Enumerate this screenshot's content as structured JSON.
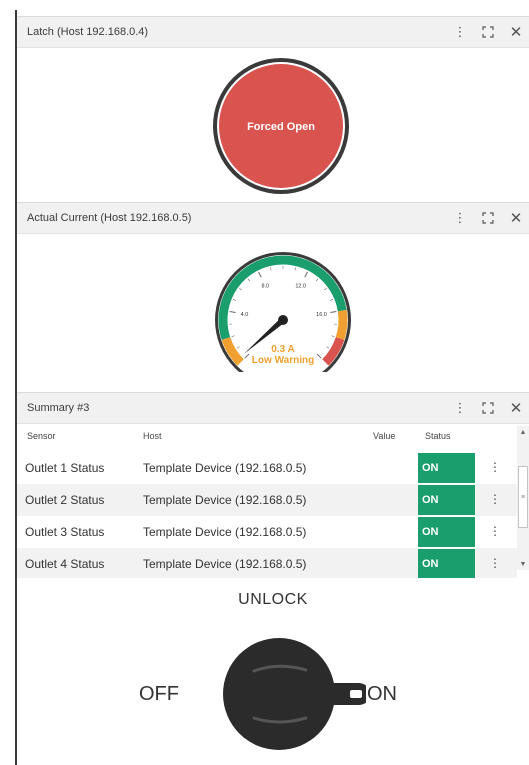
{
  "latch_panel": {
    "title": "Latch (Host 192.168.0.4)",
    "state_label": "Forced Open",
    "state_color": "#d9534f",
    "icons": [
      "kebab-icon",
      "expand-icon",
      "close-icon"
    ]
  },
  "current_panel": {
    "title": "Actual Current (Host 192.168.0.5)",
    "gauge": {
      "value": 0.3,
      "min": 0,
      "max": 20,
      "tick_labels": [
        "4.0",
        "8.0",
        "12.0",
        "16.0"
      ],
      "value_text": "0.3 A",
      "status_text": "Low Warning",
      "value_color": "#f0a030",
      "zones": [
        {
          "from": 0,
          "to": 2,
          "color": "#f0a030"
        },
        {
          "from": 2,
          "to": 16,
          "color": "#1a9e6e"
        },
        {
          "from": 16,
          "to": 18,
          "color": "#f0a030"
        },
        {
          "from": 18,
          "to": 20,
          "color": "#d9534f"
        }
      ]
    }
  },
  "summary_panel": {
    "title": "Summary #3",
    "columns": [
      "Sensor",
      "Host",
      "Value",
      "Status"
    ],
    "rows": [
      {
        "sensor": "Outlet 1 Status",
        "host": "Template Device (192.168.0.5)",
        "value": "",
        "status": "ON"
      },
      {
        "sensor": "Outlet 2 Status",
        "host": "Template Device (192.168.0.5)",
        "value": "",
        "status": "ON"
      },
      {
        "sensor": "Outlet 3 Status",
        "host": "Template Device (192.168.0.5)",
        "value": "",
        "status": "ON"
      },
      {
        "sensor": "Outlet 4 Status",
        "host": "Template Device (192.168.0.5)",
        "value": "",
        "status": "ON"
      }
    ],
    "status_color": "#1a9e6e"
  },
  "unlock_panel": {
    "title": "UNLOCK",
    "off_label": "OFF",
    "on_label": "ON",
    "switch_state": "on"
  }
}
